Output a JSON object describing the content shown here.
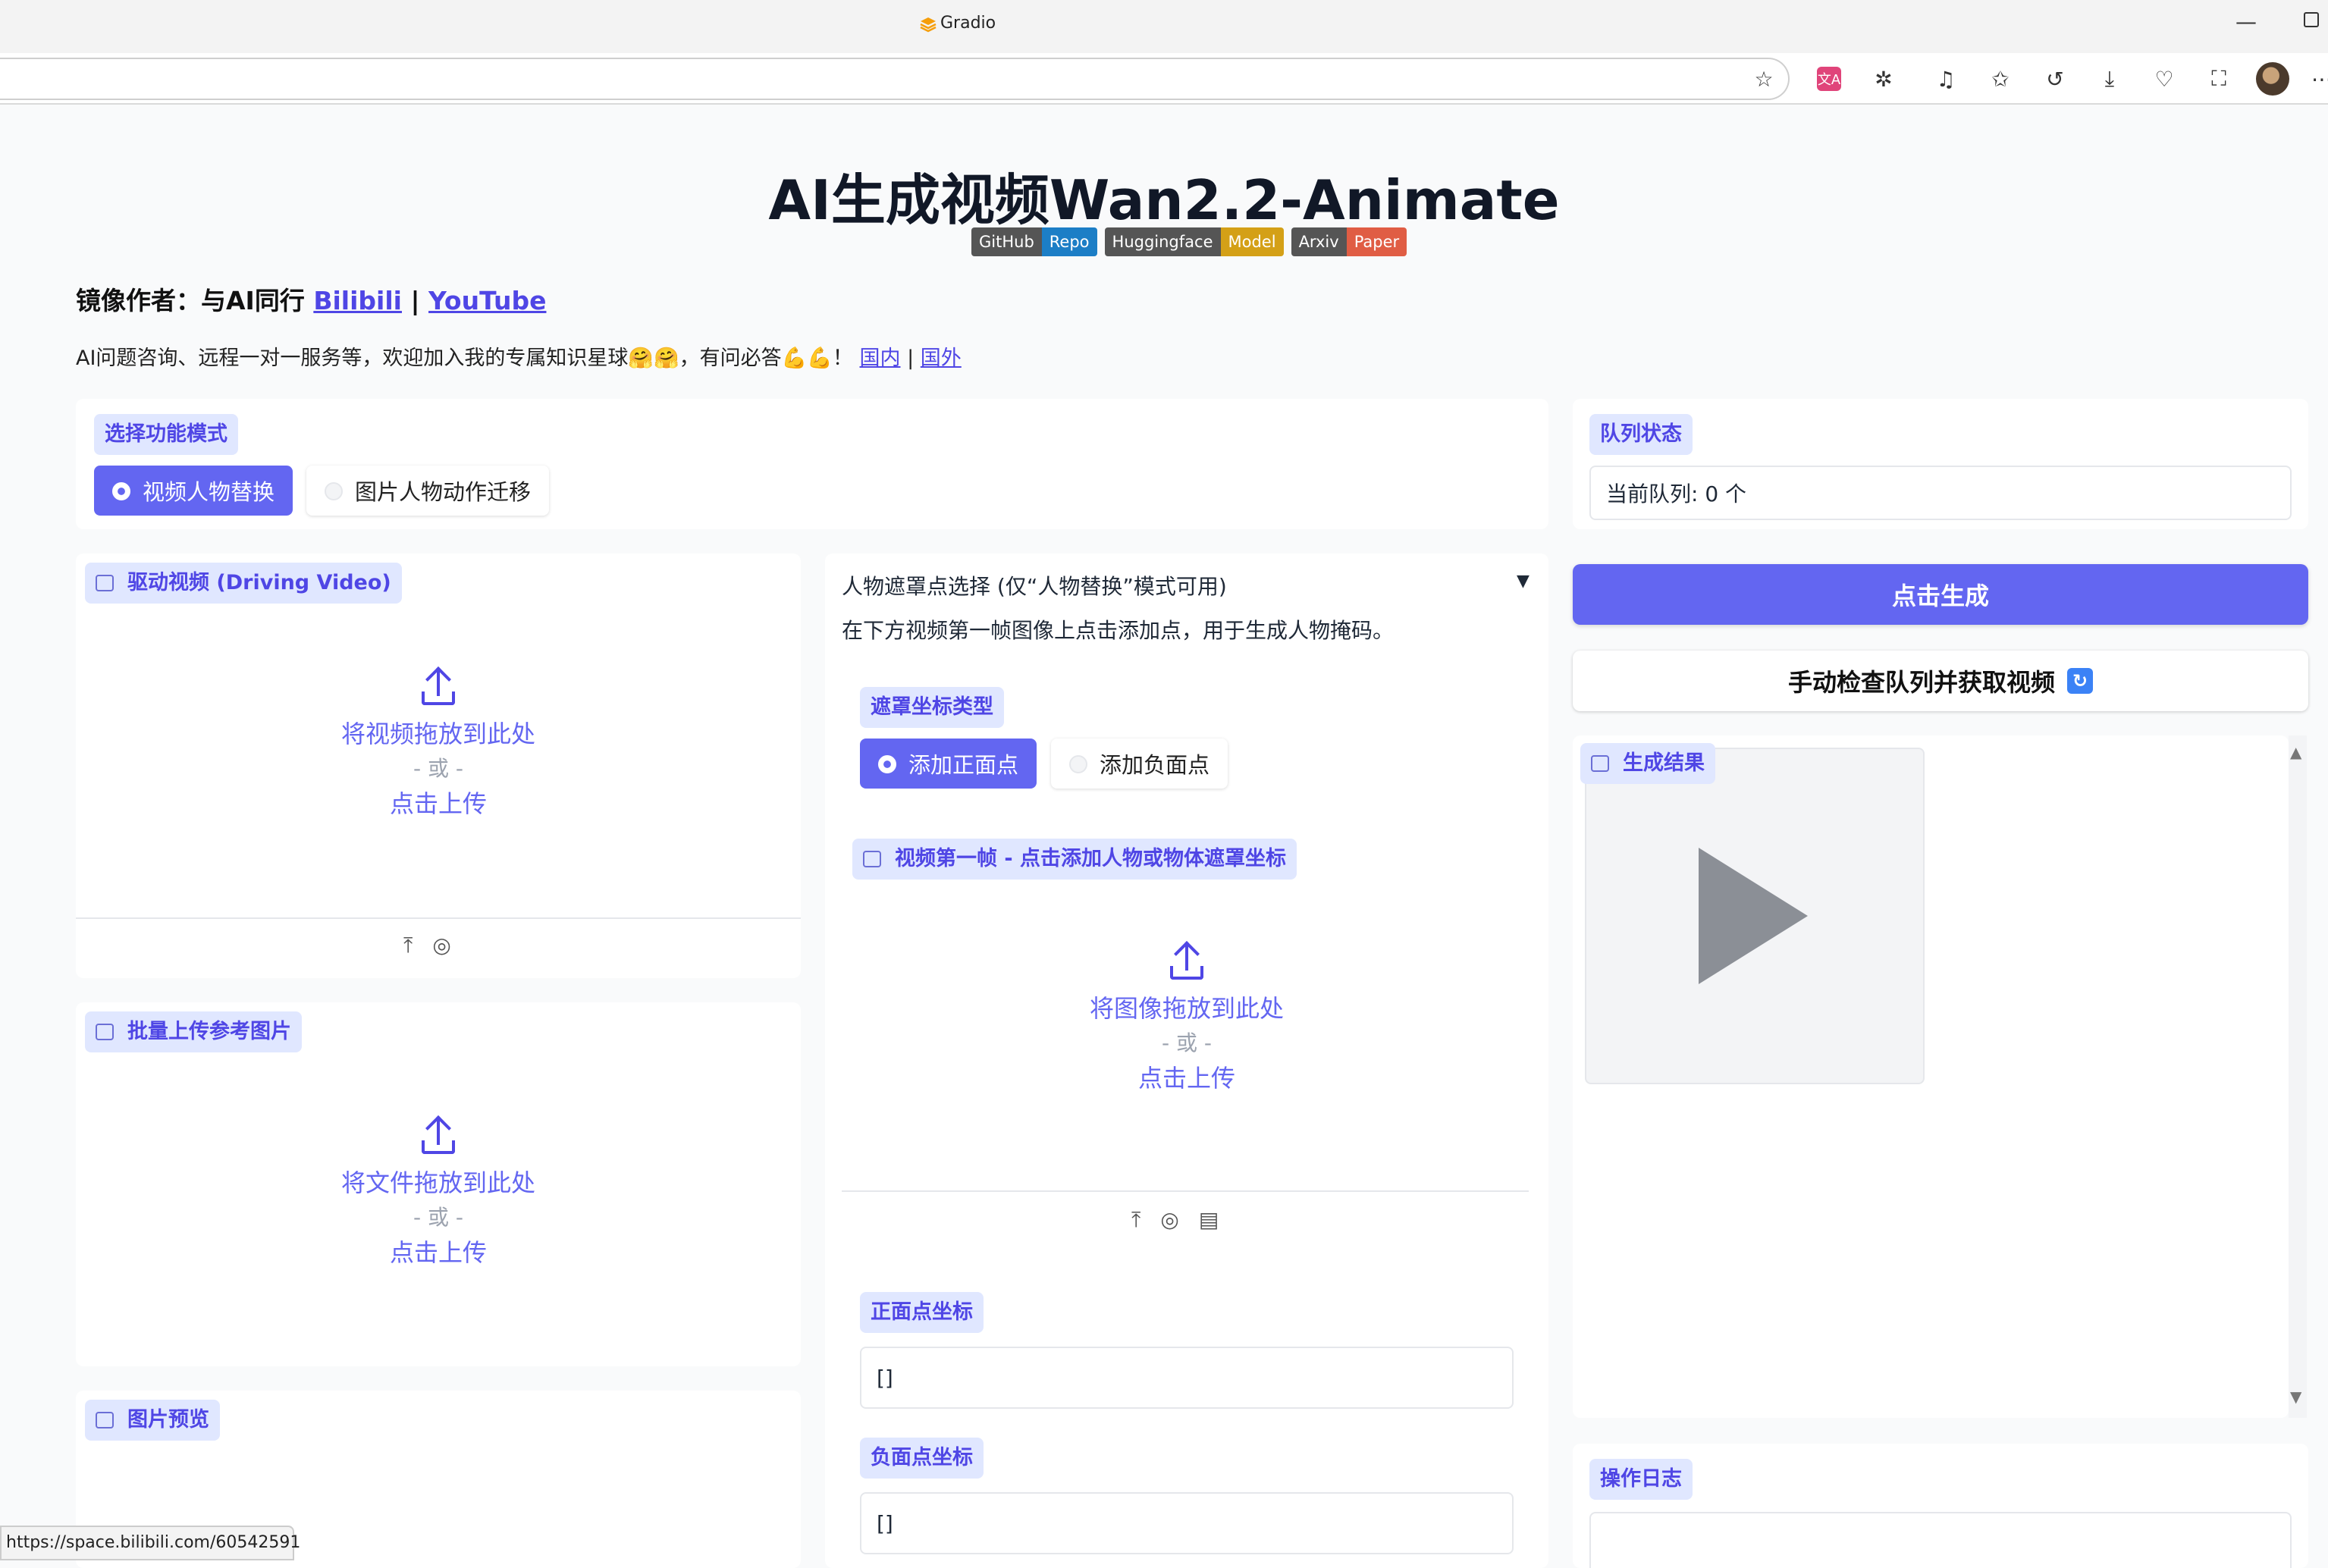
{
  "browser": {
    "tab_title": "Gradio",
    "minimize_glyph": "—",
    "url": "",
    "toolbar_icons": [
      "star-icon",
      "translate-icon",
      "extensions-icon",
      "media-icon",
      "favorites-icon",
      "history-icon",
      "download-icon",
      "health-icon",
      "screenshot-icon",
      "profile-avatar",
      "more-icon"
    ],
    "status_url": "https://space.bilibili.com/60542591"
  },
  "header": {
    "title": "AI生成视频Wan2.2-Animate",
    "badges": [
      {
        "left": "GitHub",
        "right": "Repo",
        "color": "#1c7ec6"
      },
      {
        "left": "Huggingface",
        "right": "Model",
        "color": "#d4a017"
      },
      {
        "left": "Arxiv",
        "right": "Paper",
        "color": "#e05d44"
      }
    ],
    "author_prefix": "镜像作者：与AI同行",
    "author_link1": "Bilibili",
    "author_sep": "|",
    "author_link2": "YouTube",
    "promo_text": "AI问题咨询、远程一对一服务等，欢迎加入我的专属知识星球🤗🤗，有问必答💪💪！",
    "promo_link1": "国内",
    "promo_sep": "|",
    "promo_link2": "国外"
  },
  "mode": {
    "label": "选择功能模式",
    "options": [
      "视频人物替换",
      "图片人物动作迁移"
    ],
    "selected": 0
  },
  "queue": {
    "label": "队列状态",
    "value": "当前队列: 0 个"
  },
  "driving_video": {
    "label": "驱动视频 (Driving Video)",
    "drop_text": "将视频拖放到此处",
    "or_text": "- 或 -",
    "click_text": "点击上传"
  },
  "batch_upload": {
    "label": "批量上传参考图片",
    "drop_text": "将文件拖放到此处",
    "or_text": "- 或 -",
    "click_text": "点击上传"
  },
  "image_preview": {
    "label": "图片预览"
  },
  "mask": {
    "accordion_title": "人物遮罩点选择 (仅“人物替换”模式可用)",
    "accordion_arrow": "▼",
    "description": "在下方视频第一帧图像上点击添加点，用于生成人物掩码。",
    "type_label": "遮罩坐标类型",
    "type_options": [
      "添加正面点",
      "添加负面点"
    ],
    "type_selected": 0,
    "frame_label": "视频第一帧 - 点击添加人物或物体遮罩坐标",
    "drop_text": "将图像拖放到此处",
    "or_text": "- 或 -",
    "click_text": "点击上传",
    "positive_label": "正面点坐标",
    "positive_value": "[]",
    "negative_label": "负面点坐标",
    "negative_value": "[]"
  },
  "actions": {
    "generate": "点击生成",
    "check_queue": "手动检查队列并获取视频"
  },
  "result": {
    "label": "生成结果"
  },
  "log": {
    "label": "操作日志"
  }
}
